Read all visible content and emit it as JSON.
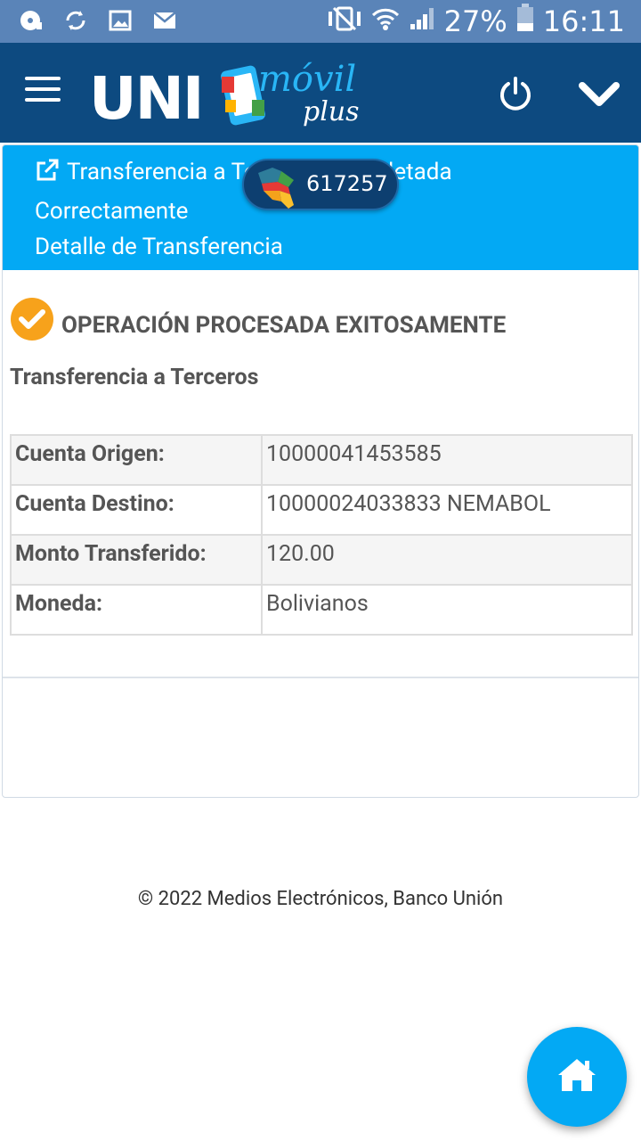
{
  "status_bar": {
    "battery_percent": "27%",
    "time": "16:11",
    "left_icons": [
      "media-icon",
      "sync-icon",
      "image-icon",
      "mail-icon"
    ],
    "right_icons": [
      "mute-icon",
      "wifi-icon",
      "signal-icon",
      "battery-icon"
    ]
  },
  "app_bar": {
    "logo_uni": "UNI",
    "logo_movil": "móvil",
    "logo_plus": "plus",
    "colors": {
      "background": "#0d4a80",
      "accent": "#29b6f6"
    }
  },
  "card": {
    "header_line1": "Transferencia a Terceros Completada",
    "header_line2": "Correctamente",
    "header_line3": "Detalle de Transferencia",
    "header_color": "#03a9f4"
  },
  "badge": {
    "number": "617257"
  },
  "result": {
    "status_text": "OPERACIÓN PROCESADA EXITOSAMENTE",
    "status_color": "#f7a21b",
    "subtitle": "Transferencia a Terceros"
  },
  "details": [
    {
      "label": "Cuenta Origen:",
      "value": "10000041453585"
    },
    {
      "label": "Cuenta Destino:",
      "value": "10000024033833 NEMABOL"
    },
    {
      "label": "Monto Transferido:",
      "value": "120.00"
    },
    {
      "label": "Moneda:",
      "value": "Bolivianos"
    }
  ],
  "footer": {
    "text": "© 2022 Medios Electrónicos, Banco Unión"
  },
  "fab": {
    "icon": "home-icon",
    "color": "#03a9f4"
  }
}
